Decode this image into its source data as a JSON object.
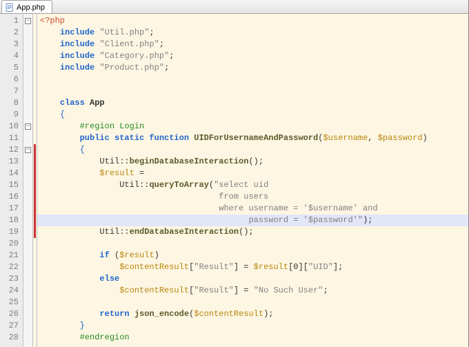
{
  "tab": {
    "label": "App.php"
  },
  "lines": [
    {
      "n": 1,
      "fold": "minus",
      "mark": false,
      "hl": false,
      "tokens": [
        [
          "tag",
          "<?php"
        ]
      ]
    },
    {
      "n": 2,
      "fold": "",
      "mark": false,
      "hl": false,
      "tokens": [
        [
          "",
          "    "
        ],
        [
          "kw",
          "include"
        ],
        [
          "",
          " "
        ],
        [
          "str",
          "\"Util.php\""
        ],
        [
          "",
          ";"
        ]
      ]
    },
    {
      "n": 3,
      "fold": "",
      "mark": false,
      "hl": false,
      "tokens": [
        [
          "",
          "    "
        ],
        [
          "kw",
          "include"
        ],
        [
          "",
          " "
        ],
        [
          "str",
          "\"Client.php\""
        ],
        [
          "",
          ";"
        ]
      ]
    },
    {
      "n": 4,
      "fold": "",
      "mark": false,
      "hl": false,
      "tokens": [
        [
          "",
          "    "
        ],
        [
          "kw",
          "include"
        ],
        [
          "",
          " "
        ],
        [
          "str",
          "\"Category.php\""
        ],
        [
          "",
          ";"
        ]
      ]
    },
    {
      "n": 5,
      "fold": "",
      "mark": false,
      "hl": false,
      "tokens": [
        [
          "",
          "    "
        ],
        [
          "kw",
          "include"
        ],
        [
          "",
          " "
        ],
        [
          "str",
          "\"Product.php\""
        ],
        [
          "",
          ";"
        ]
      ]
    },
    {
      "n": 6,
      "fold": "",
      "mark": false,
      "hl": false,
      "tokens": []
    },
    {
      "n": 7,
      "fold": "",
      "mark": false,
      "hl": false,
      "tokens": []
    },
    {
      "n": 8,
      "fold": "",
      "mark": false,
      "hl": false,
      "tokens": [
        [
          "",
          "    "
        ],
        [
          "kw",
          "class"
        ],
        [
          "",
          " "
        ],
        [
          "cls",
          "App"
        ]
      ]
    },
    {
      "n": 9,
      "fold": "",
      "mark": false,
      "hl": false,
      "tokens": [
        [
          "",
          "    "
        ],
        [
          "brace",
          "{"
        ]
      ]
    },
    {
      "n": 10,
      "fold": "minus",
      "mark": false,
      "hl": false,
      "tokens": [
        [
          "",
          "        "
        ],
        [
          "region",
          "#region Login"
        ]
      ]
    },
    {
      "n": 11,
      "fold": "",
      "mark": false,
      "hl": false,
      "tokens": [
        [
          "",
          "        "
        ],
        [
          "kw",
          "public static function"
        ],
        [
          "",
          " "
        ],
        [
          "fn",
          "UIDForUsernameAndPassword"
        ],
        [
          "",
          "("
        ],
        [
          "var",
          "$username"
        ],
        [
          "",
          ", "
        ],
        [
          "var",
          "$password"
        ],
        [
          "",
          ")"
        ]
      ]
    },
    {
      "n": 12,
      "fold": "minus",
      "mark": true,
      "hl": false,
      "tokens": [
        [
          "",
          "        "
        ],
        [
          "brace",
          "{"
        ]
      ]
    },
    {
      "n": 13,
      "fold": "",
      "mark": true,
      "hl": false,
      "tokens": [
        [
          "",
          "            Util::"
        ],
        [
          "fn",
          "beginDatabaseInteraction"
        ],
        [
          "",
          "();"
        ]
      ]
    },
    {
      "n": 14,
      "fold": "",
      "mark": true,
      "hl": false,
      "tokens": [
        [
          "",
          "            "
        ],
        [
          "var",
          "$result"
        ],
        [
          "",
          " ="
        ]
      ]
    },
    {
      "n": 15,
      "fold": "",
      "mark": true,
      "hl": false,
      "tokens": [
        [
          "",
          "                Util::"
        ],
        [
          "fn",
          "queryToArray"
        ],
        [
          "",
          "("
        ],
        [
          "str",
          "\"select uid"
        ]
      ]
    },
    {
      "n": 16,
      "fold": "",
      "mark": true,
      "hl": false,
      "tokens": [
        [
          "",
          "                                    "
        ],
        [
          "str",
          "from users"
        ]
      ]
    },
    {
      "n": 17,
      "fold": "",
      "mark": true,
      "hl": false,
      "tokens": [
        [
          "",
          "                                    "
        ],
        [
          "str",
          "where username = '$username' and"
        ]
      ]
    },
    {
      "n": 18,
      "fold": "",
      "mark": true,
      "hl": true,
      "tokens": [
        [
          "",
          "                                          "
        ],
        [
          "str",
          "password = '$password'\""
        ],
        [
          "",
          ");"
        ]
      ]
    },
    {
      "n": 19,
      "fold": "",
      "mark": true,
      "hl": false,
      "tokens": [
        [
          "",
          "            Util::"
        ],
        [
          "fn",
          "endDatabaseInteraction"
        ],
        [
          "",
          "();"
        ]
      ]
    },
    {
      "n": 20,
      "fold": "",
      "mark": false,
      "hl": false,
      "tokens": []
    },
    {
      "n": 21,
      "fold": "",
      "mark": false,
      "hl": false,
      "tokens": [
        [
          "",
          "            "
        ],
        [
          "kw",
          "if"
        ],
        [
          "",
          " ("
        ],
        [
          "var",
          "$result"
        ],
        [
          "",
          ")"
        ]
      ]
    },
    {
      "n": 22,
      "fold": "",
      "mark": false,
      "hl": false,
      "tokens": [
        [
          "",
          "                "
        ],
        [
          "var",
          "$contentResult"
        ],
        [
          "",
          "["
        ],
        [
          "str",
          "\"Result\""
        ],
        [
          "",
          "] = "
        ],
        [
          "var",
          "$result"
        ],
        [
          "",
          "[0]["
        ],
        [
          "str",
          "\"UID\""
        ],
        [
          "",
          "];"
        ]
      ]
    },
    {
      "n": 23,
      "fold": "",
      "mark": false,
      "hl": false,
      "tokens": [
        [
          "",
          "            "
        ],
        [
          "kw",
          "else"
        ]
      ]
    },
    {
      "n": 24,
      "fold": "",
      "mark": false,
      "hl": false,
      "tokens": [
        [
          "",
          "                "
        ],
        [
          "var",
          "$contentResult"
        ],
        [
          "",
          "["
        ],
        [
          "str",
          "\"Result\""
        ],
        [
          "",
          "] = "
        ],
        [
          "str",
          "\"No Such User\""
        ],
        [
          "",
          ";"
        ]
      ]
    },
    {
      "n": 25,
      "fold": "",
      "mark": false,
      "hl": false,
      "tokens": []
    },
    {
      "n": 26,
      "fold": "",
      "mark": false,
      "hl": false,
      "tokens": [
        [
          "",
          "            "
        ],
        [
          "kw",
          "return"
        ],
        [
          "",
          " "
        ],
        [
          "fn",
          "json_encode"
        ],
        [
          "",
          "("
        ],
        [
          "var",
          "$contentResult"
        ],
        [
          "",
          ");"
        ]
      ]
    },
    {
      "n": 27,
      "fold": "",
      "mark": false,
      "hl": false,
      "tokens": [
        [
          "",
          "        "
        ],
        [
          "brace",
          "}"
        ]
      ]
    },
    {
      "n": 28,
      "fold": "",
      "mark": false,
      "hl": false,
      "tokens": [
        [
          "",
          "        "
        ],
        [
          "region",
          "#endregion"
        ]
      ]
    }
  ]
}
